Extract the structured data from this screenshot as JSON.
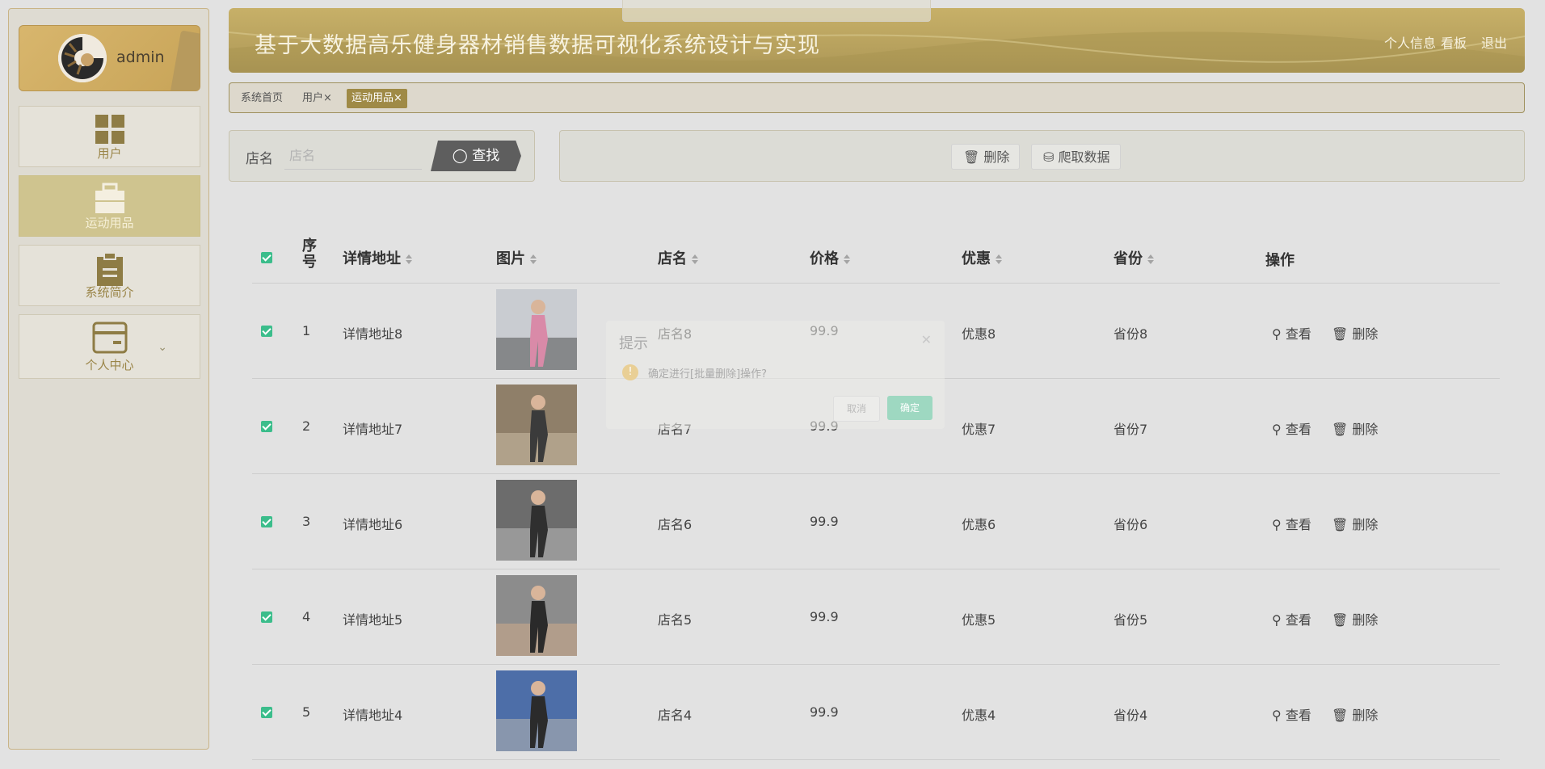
{
  "app": {
    "title": "基于大数据高乐健身器材销售数据可视化系统设计与实现"
  },
  "header": {
    "links": [
      "个人信息",
      "看板",
      "退出"
    ]
  },
  "user": {
    "name": "admin"
  },
  "sidebar": {
    "items": [
      {
        "label": "用户",
        "icon": "grid-icon"
      },
      {
        "label": "运动用品",
        "icon": "briefcase-icon",
        "active": true
      },
      {
        "label": "系统简介",
        "icon": "clipboard-icon"
      },
      {
        "label": "个人中心",
        "icon": "card-icon"
      }
    ]
  },
  "tabs": [
    {
      "label": "系统首页"
    },
    {
      "label": "用户",
      "close": "×"
    },
    {
      "label": "运动用品",
      "close": "×",
      "active": true
    }
  ],
  "search": {
    "label": "店名",
    "placeholder": "店名",
    "button": "查找"
  },
  "actions": {
    "delete": "删除",
    "crawl": "爬取数据"
  },
  "table": {
    "columns": [
      "序号",
      "详情地址",
      "图片",
      "店名",
      "价格",
      "优惠",
      "省份",
      "操作"
    ],
    "rows": [
      {
        "no": "1",
        "address": "详情地址8",
        "shop": "店名8",
        "price": "99.9",
        "discount": "优惠8",
        "province": "省份8"
      },
      {
        "no": "2",
        "address": "详情地址7",
        "shop": "店名7",
        "price": "99.9",
        "discount": "优惠7",
        "province": "省份7"
      },
      {
        "no": "3",
        "address": "详情地址6",
        "shop": "店名6",
        "price": "99.9",
        "discount": "优惠6",
        "province": "省份6"
      },
      {
        "no": "4",
        "address": "详情地址5",
        "shop": "店名5",
        "price": "99.9",
        "discount": "优惠5",
        "province": "省份5"
      },
      {
        "no": "5",
        "address": "详情地址4",
        "shop": "店名4",
        "price": "99.9",
        "discount": "优惠4",
        "province": "省份4"
      }
    ],
    "row_actions": {
      "view": "查看",
      "delete": "删除"
    }
  },
  "dialog": {
    "title": "提示",
    "message": "确定进行[批量删除]操作?",
    "cancel": "取消",
    "ok": "确定"
  },
  "colors": {
    "accent": "#9f8a46",
    "header": "#b8a25e",
    "checkbox": "#3bbd8b"
  }
}
